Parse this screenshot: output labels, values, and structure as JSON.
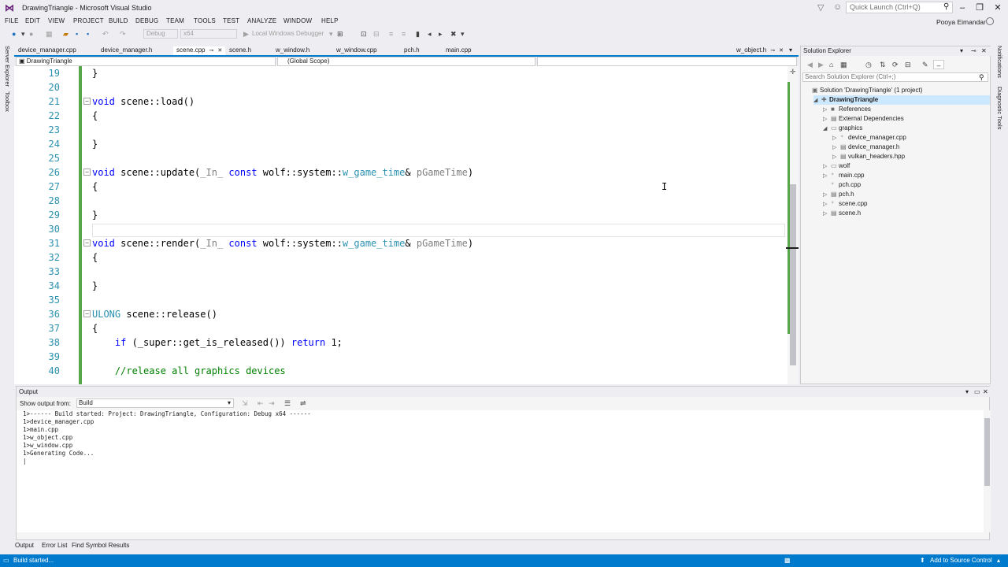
{
  "window": {
    "title": "DrawingTriangle - Microsoft Visual Studio",
    "quick_launch_placeholder": "Quick Launch (Ctrl+Q)",
    "user": "Pooya Eimandar"
  },
  "menu": [
    "FILE",
    "EDIT",
    "VIEW",
    "PROJECT",
    "BUILD",
    "DEBUG",
    "TEAM",
    "TOOLS",
    "TEST",
    "ANALYZE",
    "WINDOW",
    "HELP"
  ],
  "toolbar": {
    "config": "Debug",
    "platform": "x64",
    "debugger": "Local Windows Debugger"
  },
  "left_rail": [
    "Server Explorer",
    "Toolbox"
  ],
  "right_rail": [
    "Notifications",
    "Diagnostic Tools"
  ],
  "doc_tabs": [
    "device_manager.cpp",
    "device_manager.h",
    "scene.cpp",
    "scene.h",
    "w_window.h",
    "w_window.cpp",
    "pch.h",
    "main.cpp",
    "w_object.h"
  ],
  "nav": {
    "project": "DrawingTriangle",
    "scope": "(Global Scope)"
  },
  "code_lines": [
    {
      "n": "19",
      "parts": [
        [
          "p",
          "}"
        ]
      ],
      "fold": false
    },
    {
      "n": "20",
      "parts": [],
      "fold": false
    },
    {
      "n": "21",
      "parts": [
        [
          "kw",
          "void"
        ],
        [
          "p",
          " scene::load()"
        ]
      ],
      "fold": true
    },
    {
      "n": "22",
      "parts": [
        [
          "p",
          "{"
        ]
      ],
      "fold": false
    },
    {
      "n": "23",
      "parts": [],
      "fold": false
    },
    {
      "n": "24",
      "parts": [
        [
          "p",
          "}"
        ]
      ],
      "fold": false
    },
    {
      "n": "25",
      "parts": [],
      "fold": false
    },
    {
      "n": "26",
      "parts": [
        [
          "kw",
          "void"
        ],
        [
          "p",
          " scene::update("
        ],
        [
          "gr",
          "_In_"
        ],
        [
          "p",
          " "
        ],
        [
          "kw",
          "const"
        ],
        [
          "p",
          " wolf::system::"
        ],
        [
          "ty",
          "w_game_time"
        ],
        [
          "p",
          "& "
        ],
        [
          "gr",
          "pGameTime"
        ],
        [
          "p",
          ")"
        ]
      ],
      "fold": true
    },
    {
      "n": "27",
      "parts": [
        [
          "p",
          "{"
        ]
      ],
      "fold": false
    },
    {
      "n": "28",
      "parts": [],
      "fold": false
    },
    {
      "n": "29",
      "parts": [
        [
          "p",
          "}"
        ]
      ],
      "fold": false
    },
    {
      "n": "30",
      "parts": [],
      "fold": false
    },
    {
      "n": "31",
      "parts": [
        [
          "kw",
          "void"
        ],
        [
          "p",
          " scene::render("
        ],
        [
          "gr",
          "_In_"
        ],
        [
          "p",
          " "
        ],
        [
          "kw",
          "const"
        ],
        [
          "p",
          " wolf::system::"
        ],
        [
          "ty",
          "w_game_time"
        ],
        [
          "p",
          "& "
        ],
        [
          "gr",
          "pGameTime"
        ],
        [
          "p",
          ")"
        ]
      ],
      "fold": true
    },
    {
      "n": "32",
      "parts": [
        [
          "p",
          "{"
        ]
      ],
      "fold": false
    },
    {
      "n": "33",
      "parts": [],
      "fold": false
    },
    {
      "n": "34",
      "parts": [
        [
          "p",
          "}"
        ]
      ],
      "fold": false
    },
    {
      "n": "35",
      "parts": [],
      "fold": false
    },
    {
      "n": "36",
      "parts": [
        [
          "ty",
          "ULONG"
        ],
        [
          "p",
          " scene::release()"
        ]
      ],
      "fold": true
    },
    {
      "n": "37",
      "parts": [
        [
          "p",
          "{"
        ]
      ],
      "fold": false
    },
    {
      "n": "38",
      "parts": [
        [
          "p",
          "    "
        ],
        [
          "kw",
          "if"
        ],
        [
          "p",
          " (_super::get_is_released()) "
        ],
        [
          "kw",
          "return"
        ],
        [
          "p",
          " 1;"
        ]
      ],
      "fold": false
    },
    {
      "n": "39",
      "parts": [],
      "fold": false
    },
    {
      "n": "40",
      "parts": [
        [
          "p",
          "    "
        ],
        [
          "cm",
          "//release all graphics devices"
        ]
      ],
      "fold": false
    }
  ],
  "solution": {
    "title": "Solution Explorer",
    "search_placeholder": "Search Solution Explorer (Ctrl+;)",
    "items": [
      {
        "label": "Solution 'DrawingTriangle' (1 project)",
        "indent": 0,
        "arrow": "",
        "icon": "▣",
        "sel": false
      },
      {
        "label": "DrawingTriangle",
        "indent": 1,
        "arrow": "◢",
        "icon": "✚",
        "sel": true
      },
      {
        "label": "References",
        "indent": 2,
        "arrow": "▷",
        "icon": "■",
        "sel": false
      },
      {
        "label": "External Dependencies",
        "indent": 2,
        "arrow": "▷",
        "icon": "▤",
        "sel": false
      },
      {
        "label": "graphics",
        "indent": 2,
        "arrow": "◢",
        "icon": "▭",
        "sel": false
      },
      {
        "label": "device_manager.cpp",
        "indent": 3,
        "arrow": "▷",
        "icon": "⁺",
        "sel": false
      },
      {
        "label": "device_manager.h",
        "indent": 3,
        "arrow": "▷",
        "icon": "▤",
        "sel": false
      },
      {
        "label": "vulkan_headers.hpp",
        "indent": 3,
        "arrow": "▷",
        "icon": "▤",
        "sel": false
      },
      {
        "label": "wolf",
        "indent": 2,
        "arrow": "▷",
        "icon": "▭",
        "sel": false
      },
      {
        "label": "main.cpp",
        "indent": 2,
        "arrow": "▷",
        "icon": "⁺",
        "sel": false
      },
      {
        "label": "pch.cpp",
        "indent": 2,
        "arrow": "",
        "icon": "⁺",
        "sel": false
      },
      {
        "label": "pch.h",
        "indent": 2,
        "arrow": "▷",
        "icon": "▤",
        "sel": false
      },
      {
        "label": "scene.cpp",
        "indent": 2,
        "arrow": "▷",
        "icon": "⁺",
        "sel": false
      },
      {
        "label": "scene.h",
        "indent": 2,
        "arrow": "▷",
        "icon": "▤",
        "sel": false
      }
    ]
  },
  "output": {
    "title": "Output",
    "show_from_label": "Show output from:",
    "source": "Build",
    "text": "1>------ Build started: Project: DrawingTriangle, Configuration: Debug x64 ------\n1>device_manager.cpp\n1>main.cpp\n1>w_object.cpp\n1>w_window.cpp\n1>Generating Code...\n|"
  },
  "bottom_tabs": [
    "Output",
    "Error List",
    "Find Symbol Results"
  ],
  "status": {
    "left": "Build started...",
    "right": "Add to Source Control"
  }
}
